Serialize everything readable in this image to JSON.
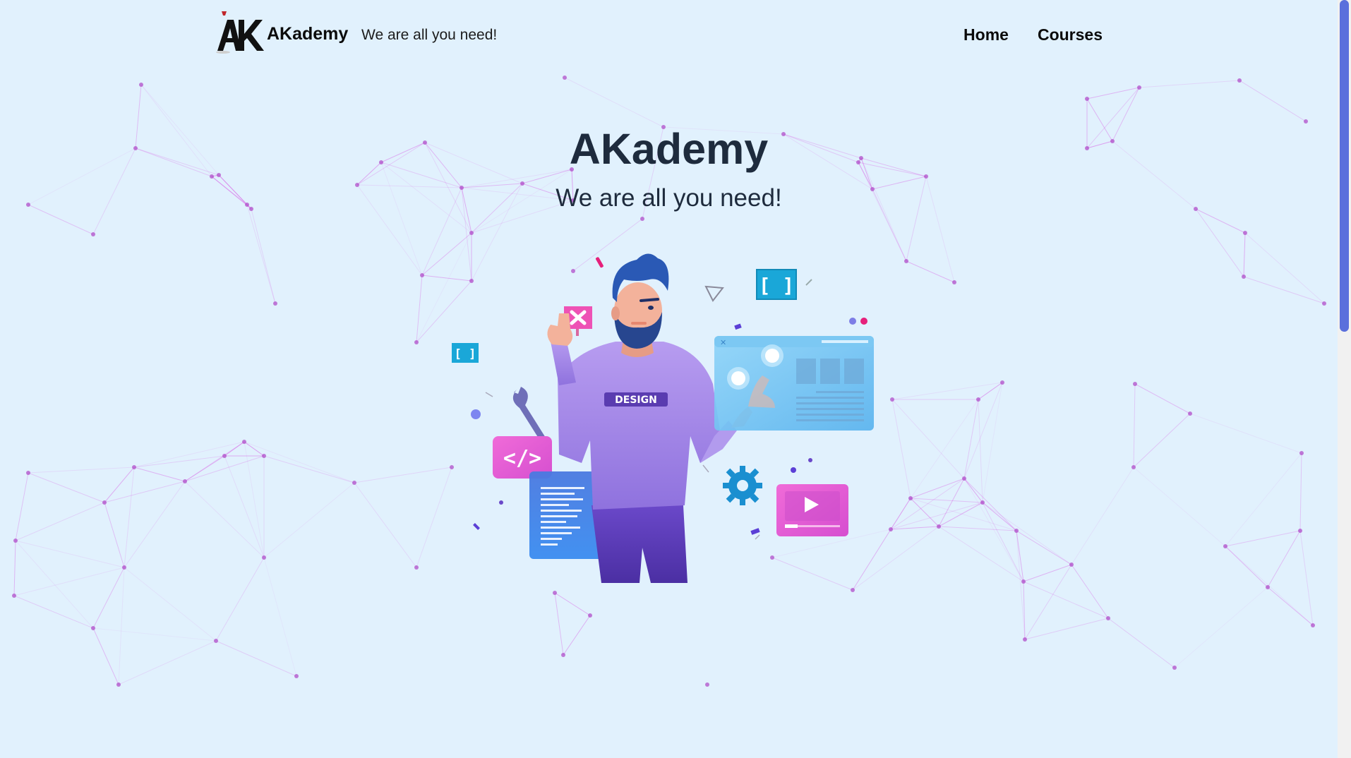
{
  "nav": {
    "brand_name": "AKademy",
    "tagline": "We are all you need!",
    "links": [
      {
        "label": "Home"
      },
      {
        "label": "Courses"
      }
    ]
  },
  "hero": {
    "title": "AKademy",
    "subtitle": "We are all you need!"
  },
  "illustration": {
    "shirt_text": "DESIGN",
    "icon_names": [
      "close-icon",
      "brackets-icon",
      "code-icon",
      "wrench-icon",
      "gear-icon",
      "play-icon"
    ]
  },
  "colors": {
    "background": "#e1f1fd",
    "network_line": "#d86ee8",
    "network_node": "#b04fc9",
    "heading": "#1e2b3d",
    "scrollbar_thumb": "#5a6fdc"
  }
}
